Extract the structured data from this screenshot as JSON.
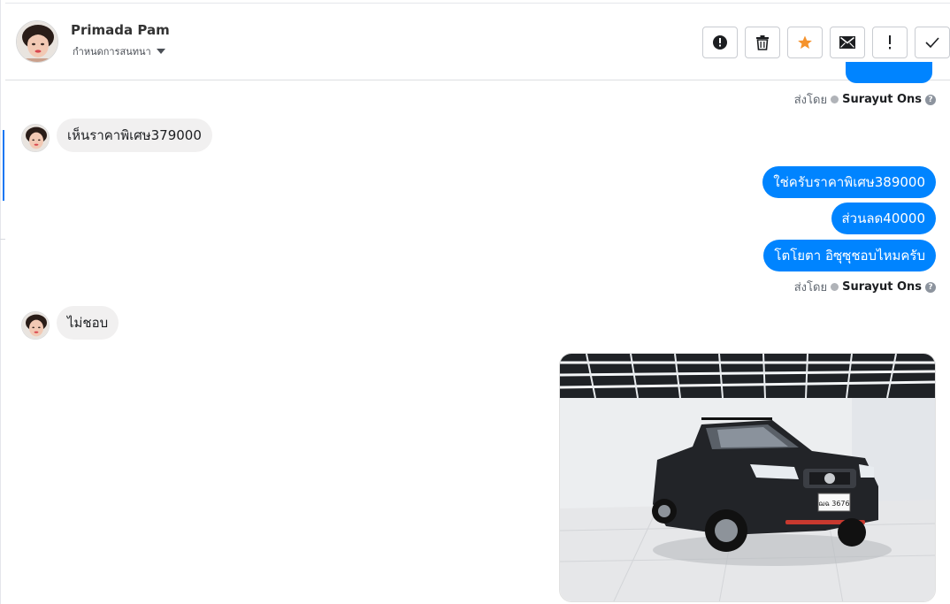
{
  "header": {
    "contact_name": "Primada Pam",
    "assign_label": "กำหนดการสนทนา",
    "actions": [
      {
        "name": "report-spam-button",
        "icon": "alert-circle-icon"
      },
      {
        "name": "delete-button",
        "icon": "trash-icon"
      },
      {
        "name": "star-button",
        "icon": "star-icon",
        "color": "#f5922b"
      },
      {
        "name": "mark-unread-button",
        "icon": "envelope-icon"
      },
      {
        "name": "follow-up-button",
        "icon": "exclamation-icon"
      },
      {
        "name": "mark-done-button",
        "icon": "checkmark-icon"
      }
    ]
  },
  "sent_by": {
    "label": "ส่งโดย",
    "agent": "Surayut Ons"
  },
  "messages": {
    "m1": "เห็นราคาพิเศษ379000",
    "m2": "ใช่ครับราคาพิเศษ389000",
    "m3": "ส่วนลด40000",
    "m4": "โตโยตา อิซุซุชอบไหมครับ",
    "m5": "ไม่ชอบ"
  },
  "photo": {
    "plate": "ฌฉ 3676"
  },
  "colors": {
    "outgoing_bubble": "#0084ff",
    "incoming_bubble": "#f1f0f0",
    "accent": "#1877f2"
  }
}
